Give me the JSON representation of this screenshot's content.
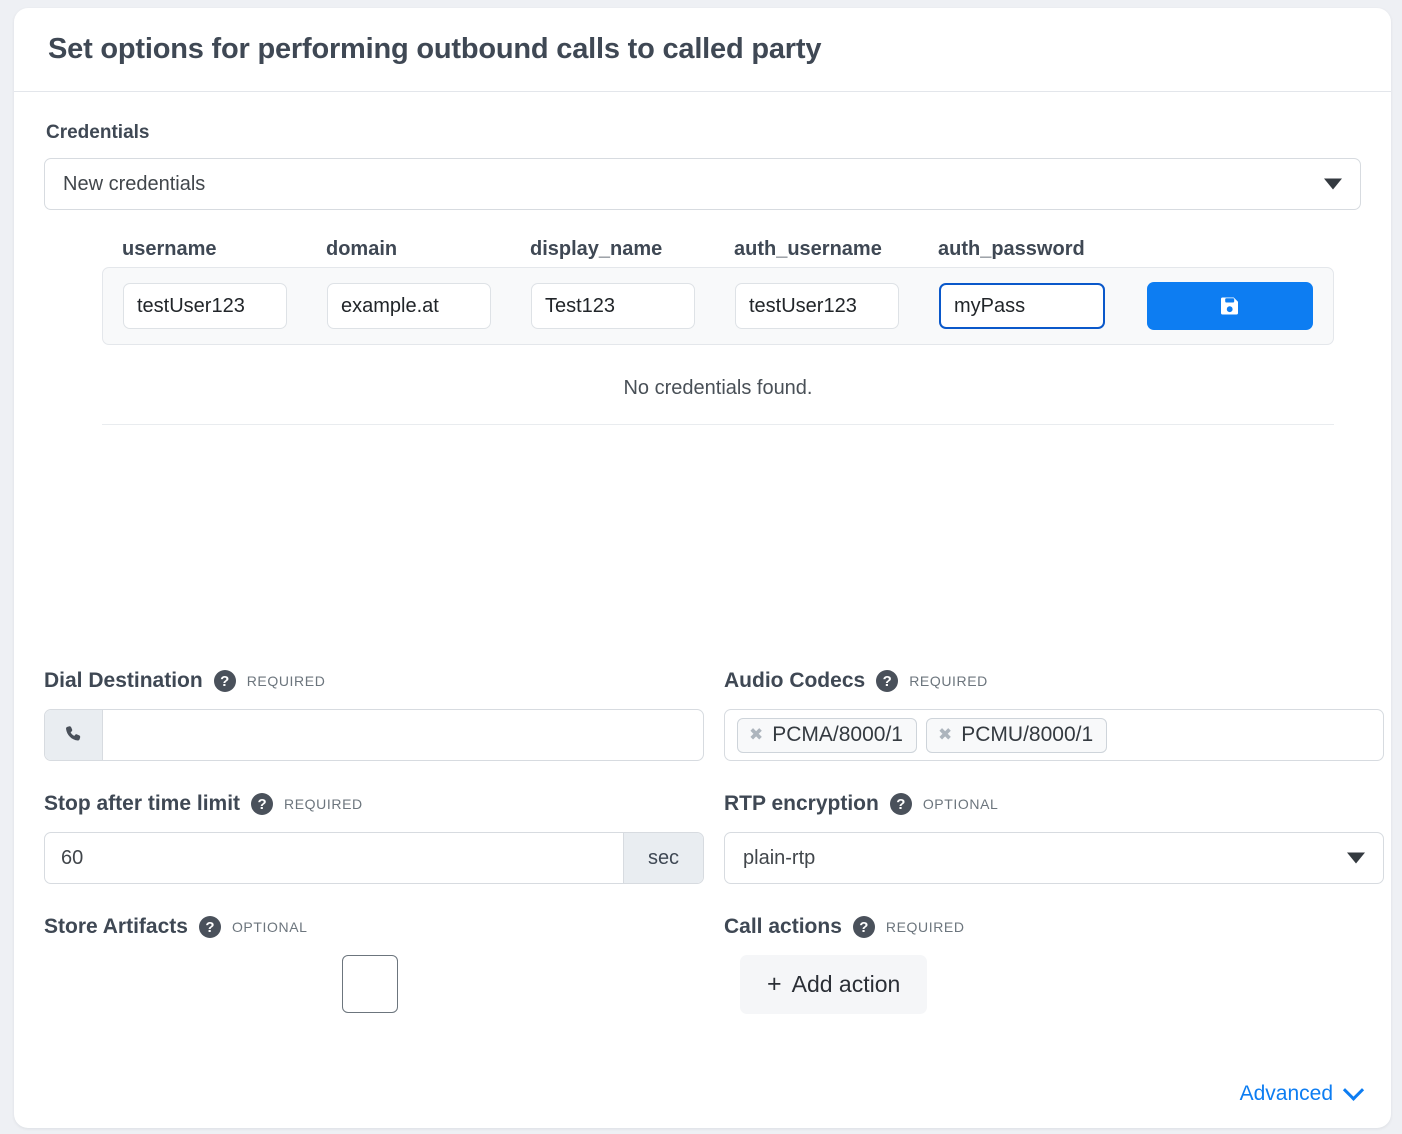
{
  "header": {
    "title": "Set options for performing outbound calls to called party"
  },
  "credentials": {
    "label": "Credentials",
    "selected": "New credentials",
    "columns": [
      "username",
      "domain",
      "display_name",
      "auth_username",
      "auth_password"
    ],
    "row": {
      "username": "testUser123",
      "domain": "example.at",
      "display_name": "Test123",
      "auth_username": "testUser123",
      "auth_password": "myPass"
    },
    "save_icon": "save-floppy-icon",
    "empty_text": "No credentials found."
  },
  "fields": {
    "dial_destination": {
      "label": "Dial Destination",
      "badge": "REQUIRED",
      "help": "?",
      "prefix_icon": "phone-icon",
      "value": "",
      "placeholder": ""
    },
    "audio_codecs": {
      "label": "Audio Codecs",
      "badge": "REQUIRED",
      "help": "?",
      "tags": [
        "PCMA/8000/1",
        "PCMU/8000/1"
      ],
      "remove_glyph": "✖"
    },
    "stop_after_time_limit": {
      "label": "Stop after time limit",
      "badge": "REQUIRED",
      "help": "?",
      "value": "60",
      "suffix": "sec"
    },
    "rtp_encryption": {
      "label": "RTP encryption",
      "badge": "OPTIONAL",
      "help": "?",
      "selected": "plain-rtp"
    },
    "store_artifacts": {
      "label": "Store Artifacts",
      "badge": "OPTIONAL",
      "help": "?",
      "checked": false
    },
    "call_actions": {
      "label": "Call actions",
      "badge": "REQUIRED",
      "help": "?",
      "add_label": "Add action",
      "add_plus": "+"
    }
  },
  "footer": {
    "advanced_label": "Advanced",
    "chevron": "chevron-down-icon"
  },
  "colors": {
    "accent": "#0d7df2",
    "focus_border": "#0a58ca",
    "text": "#3f4854",
    "muted": "#6c757d"
  }
}
